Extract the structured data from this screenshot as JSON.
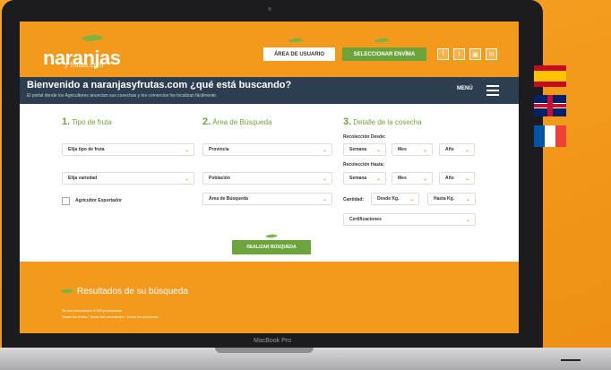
{
  "header": {
    "logo_main": "naranjas",
    "logo_sub": "y frutas.com",
    "btn_user": "ÁREA DE USUARIO",
    "btn_select": "SELECCIONAR ENVÍMA",
    "social": [
      "f",
      "t",
      "▣",
      "✉"
    ]
  },
  "banner": {
    "title": "Bienvenido a naranjasyfrutas.com ¿qué está buscando?",
    "subtitle": "El portal donde los Agricultores anuncian sus cosechas y los comercios los localizan fácilmente.",
    "menu_label": "MENÚ"
  },
  "form": {
    "sec1_num": "1.",
    "sec1_title": "Tipo de fruta",
    "sec2_num": "2.",
    "sec2_title": "Área de Búsqueda",
    "sec3_num": "3.",
    "sec3_title": "Detalle de la cosecha",
    "tipo_fruta": "Elija tipo de fruta",
    "variedad": "Elija variedad",
    "checkbox_label": "Agricultor Exportador",
    "provincia": "Provincia",
    "poblacion": "Población",
    "area_busqueda": "Área de Búsqueda",
    "recoleccion_desde": "Recolección Desde:",
    "recoleccion_hasta": "Recolección Hasta:",
    "semana": "Semana",
    "mes": "Mes",
    "anio": "Año",
    "cantidad_label": "Cantidad:",
    "desde_kg": "Desde Kg.",
    "hasta_kg": "Hasta Kg.",
    "certificaciones": "Certificaciones",
    "search_button": "REALIZAR BÚSQUEDA"
  },
  "results": {
    "title": "Resultados de su búsqueda",
    "count_text": "Se han encontrado 3.153 productores",
    "breadcrumb": "Todas las frutas / Todas las variedades / Todas las provincias"
  },
  "device_label": "MacBook Pro",
  "colors": {
    "brand_orange": "#f39a1c",
    "brand_green": "#6ba43a",
    "banner_navy": "#2c3e4f"
  }
}
